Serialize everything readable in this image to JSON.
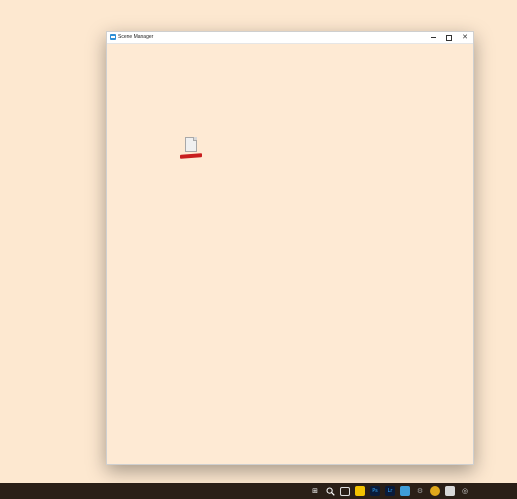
{
  "window": {
    "title": "Scene Manager",
    "controls": {
      "minimize": "—",
      "maximize": "☐",
      "close": "✕"
    }
  },
  "content": {
    "items": [
      {
        "icon": "document-icon"
      }
    ]
  },
  "taskbar": {
    "icons": [
      {
        "name": "start-icon",
        "glyph": "⊞",
        "color": "#3aa0ff"
      },
      {
        "name": "search-icon",
        "glyph": "🔍",
        "color": "#ffffff"
      },
      {
        "name": "task-view-icon",
        "glyph": "▭",
        "color": "#ffffff"
      },
      {
        "name": "file-explorer-icon",
        "glyph": "▬",
        "color": "#f2c200"
      },
      {
        "name": "photoshop-icon",
        "glyph": "Ps",
        "color": "#0a1b3a"
      },
      {
        "name": "lightroom-icon",
        "glyph": "Lr",
        "color": "#0a1b3a"
      },
      {
        "name": "app-icon",
        "glyph": "▣",
        "color": "#3e9dd9"
      },
      {
        "name": "settings-icon",
        "glyph": "⚙",
        "color": "#6a6a6a"
      },
      {
        "name": "chrome-icon",
        "glyph": "◉",
        "color": "#e0a81b"
      },
      {
        "name": "media-icon",
        "glyph": "▦",
        "color": "#d8d8d8"
      },
      {
        "name": "player-icon",
        "glyph": "◎",
        "color": "#d8d8d8"
      }
    ]
  }
}
